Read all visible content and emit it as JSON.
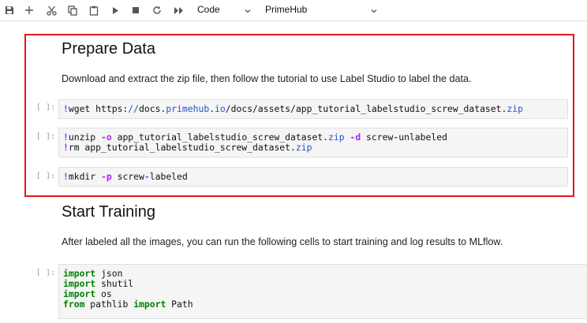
{
  "toolbar": {
    "icons": [
      "save-icon",
      "add-icon",
      "cut-icon",
      "copy-icon",
      "paste-icon",
      "run-icon",
      "stop-icon",
      "restart-icon",
      "run-all-icon"
    ],
    "cell_type": "Code",
    "kernel": "PrimeHub"
  },
  "notebook": {
    "prepare_heading": "Prepare Data",
    "prepare_text": "Download and extract the zip file, then follow the tutorial to use Label Studio to label the data.",
    "prompt": "[ ]:",
    "cell1": {
      "bang": "!",
      "cmd": "wget https:",
      "slashes": "//",
      "url_a": "docs.",
      "url_b": "primehub",
      "url_c": ".",
      "url_d": "io",
      "url_e": "/docs/assets/app_tutorial_labelstudio_screw_dataset.",
      "url_f": "zip"
    },
    "cell2": {
      "line1_bang": "!",
      "line1_a": "unzip ",
      "line1_op1": "-o",
      "line1_b": " app_tutorial_labelstudio_screw_dataset.",
      "line1_zip": "zip",
      "line1_sp": " ",
      "line1_op2": "-d",
      "line1_c": " screw",
      "line1_dash": "-",
      "line1_d": "unlabeled",
      "line2_bang": "!",
      "line2_a": "rm app_tutorial_labelstudio_screw_dataset.",
      "line2_zip": "zip"
    },
    "cell3": {
      "bang": "!",
      "a": "mkdir ",
      "op": "-p",
      "b": " screw",
      "dash": "-",
      "c": "labeled"
    },
    "training_heading": "Start Training",
    "training_text": "After labeled all the images, you can run the following cells to start training and log results to MLflow.",
    "cell4": {
      "kw_import": "import",
      "kw_from": "from",
      "mod1": " json",
      "mod2": " shutil",
      "mod3": " os",
      "mod4a": " pathlib ",
      "mod4b": " Path"
    }
  },
  "colors": {
    "selection_border": "#e8141c",
    "keyword": "#008000",
    "operator": "#aa22ff",
    "url": "#2255cc"
  }
}
